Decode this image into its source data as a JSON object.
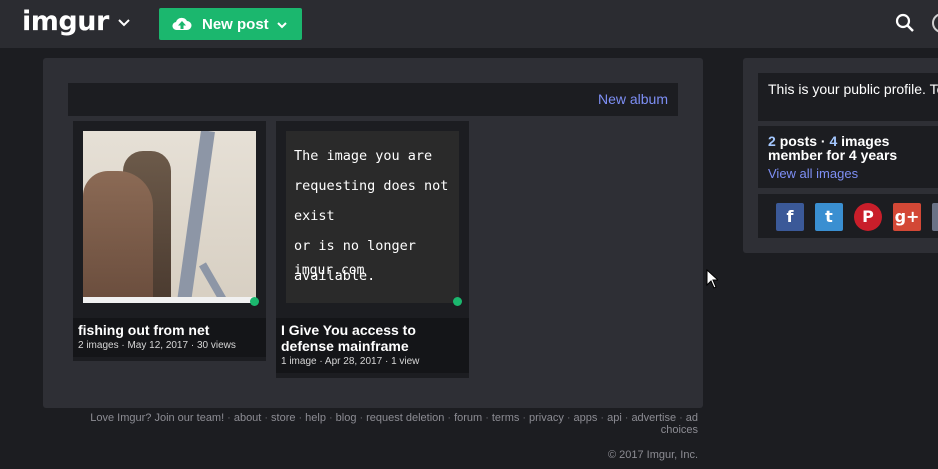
{
  "header": {
    "logo_text": "imgur",
    "new_post_label": "New post",
    "accent_color": "#1bb76e"
  },
  "album_bar": {
    "new_album_label": "New album"
  },
  "posts": [
    {
      "title": "fishing out from net",
      "meta": "2 images · May 12, 2017 · 30 views",
      "thumbnail": "photo"
    },
    {
      "title": "I Give You access to defense mainframe",
      "meta": "1 image · Apr 28, 2017 · 1 view",
      "thumbnail": "missing-image",
      "thumbnail_lines": [
        "The image you are",
        "requesting does not exist",
        "or is no longer available."
      ],
      "thumbnail_site": "imgur.com"
    }
  ],
  "sidebar": {
    "bio": "This is your public profile. Tell us about yourself!",
    "posts_count": "2",
    "posts_label": "posts",
    "images_count": "4",
    "images_label": "images",
    "member_for": "member for 4 years",
    "view_all_label": "View all images",
    "social_icons": [
      "facebook-icon",
      "twitter-icon",
      "pinterest-icon",
      "google-plus-icon",
      "share-icon"
    ]
  },
  "footer": {
    "links": [
      "Love Imgur? Join our team!",
      "about",
      "store",
      "help",
      "blog",
      "request deletion",
      "forum",
      "terms",
      "privacy",
      "apps",
      "api",
      "advertise",
      "ad choices"
    ],
    "copyright": "© 2017 Imgur, Inc."
  }
}
